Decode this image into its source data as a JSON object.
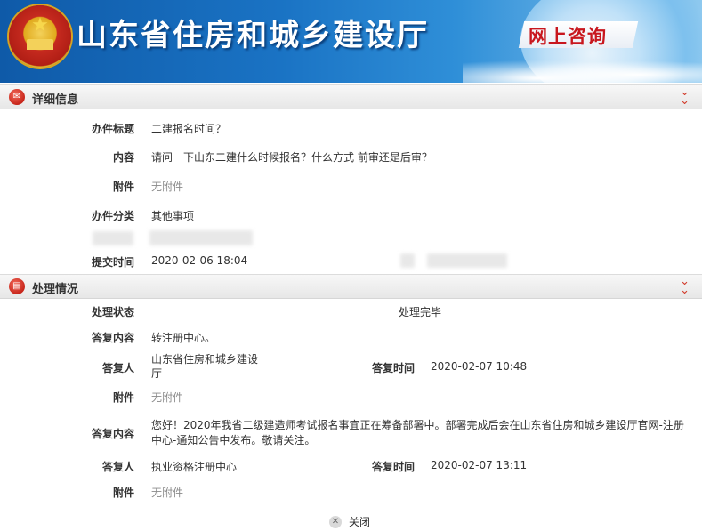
{
  "header": {
    "title": "山东省住房和城乡建设厅",
    "banner_label": "网上咨询"
  },
  "details": {
    "section_title": "详细信息",
    "subject_label": "办件标题",
    "subject_value": "二建报名时间？",
    "content_label": "内容",
    "content_value": "请问一下山东二建什么时候报名？什么方式 前审还是后审？",
    "attachment_label": "附件",
    "attachment_value": "无附件",
    "category_label": "办件分类",
    "category_value": "其他事项",
    "submit_time_label": "提交时间",
    "submit_time_value": "2020-02-06 18:04"
  },
  "processing": {
    "section_title": "处理情况",
    "status_label": "处理状态",
    "status_value": "处理完毕",
    "replies": [
      {
        "content_label": "答复内容",
        "content_value": "转注册中心。",
        "replier_label": "答复人",
        "replier_value": "山东省住房和城乡建设厅",
        "time_label": "答复时间",
        "time_value": "2020-02-07 10:48",
        "attachment_label": "附件",
        "attachment_value": "无附件"
      },
      {
        "content_label": "答复内容",
        "content_value": "您好！2020年我省二级建造师考试报名事宜正在筹备部署中。部署完成后会在山东省住房和城乡建设厅官网-注册中心-通知公告中发布。敬请关注。",
        "replier_label": "答复人",
        "replier_value": "执业资格注册中心",
        "time_label": "答复时间",
        "time_value": "2020-02-07 13:11",
        "attachment_label": "附件",
        "attachment_value": "无附件"
      }
    ]
  },
  "footer": {
    "close_label": "关闭"
  },
  "colors": {
    "header_blue": "#1a73c4",
    "accent_red": "#c8261b",
    "banner_text_red": "#c8161d"
  }
}
